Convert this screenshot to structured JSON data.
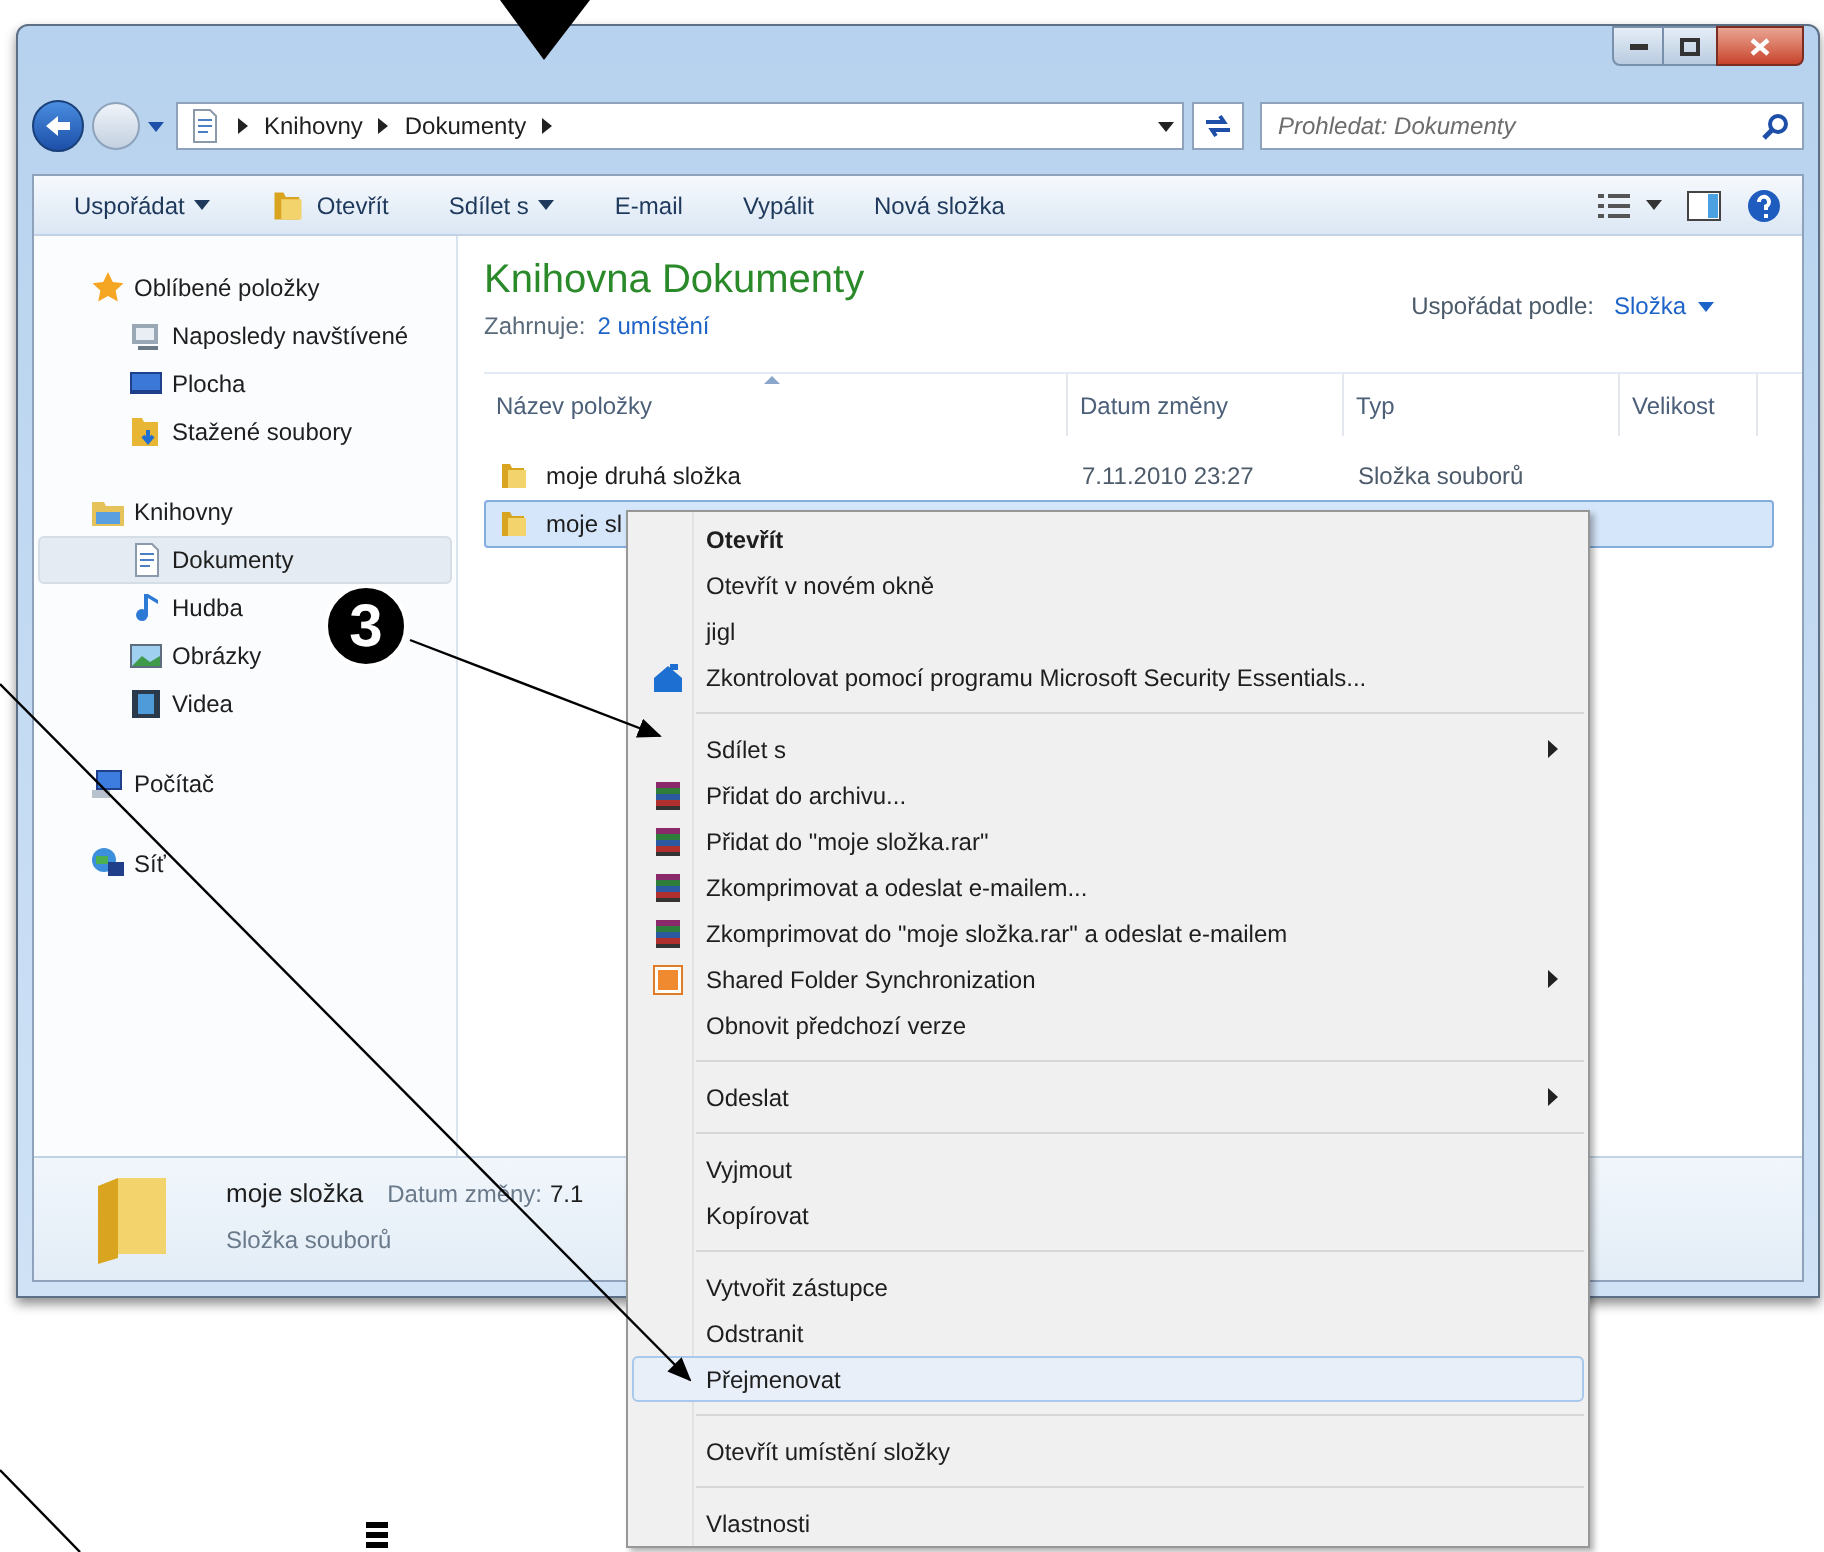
{
  "window": {
    "controls": [
      {
        "kind": "minimize"
      },
      {
        "kind": "maximize"
      },
      {
        "kind": "close"
      }
    ]
  },
  "address_bar": {
    "breadcrumb": [
      "Knihovny",
      "Dokumenty"
    ],
    "search": {
      "placeholder": "Prohledat: Dokumenty"
    }
  },
  "toolbar": {
    "buttons": [
      {
        "label": "Uspořádat",
        "kind": "dropdown"
      },
      {
        "label": "Otevřít",
        "kind": "open"
      },
      {
        "label": "Sdílet s",
        "kind": "dropdown"
      },
      {
        "label": "E-mail",
        "kind": "plain"
      },
      {
        "label": "Vypálit",
        "kind": "plain"
      },
      {
        "label": "Nová složka",
        "kind": "plain"
      }
    ]
  },
  "sidebar": {
    "sections": [
      {
        "label": "Oblíbené položky",
        "kind": "favorites",
        "selected": false,
        "children": [
          {
            "label": "Naposledy navštívené",
            "kind": "recent",
            "selected": false
          },
          {
            "label": "Plocha",
            "kind": "desktop",
            "selected": false
          },
          {
            "label": "Stažené soubory",
            "kind": "downloads",
            "selected": false
          }
        ]
      },
      {
        "label": "Knihovny",
        "kind": "libraries",
        "selected": false,
        "children": [
          {
            "label": "Dokumenty",
            "kind": "documents",
            "selected": true
          },
          {
            "label": "Hudba",
            "kind": "music",
            "selected": false
          },
          {
            "label": "Obrázky",
            "kind": "pictures",
            "selected": false
          },
          {
            "label": "Videa",
            "kind": "videos",
            "selected": false
          }
        ]
      },
      {
        "label": "Počítač",
        "kind": "computer",
        "selected": false
      },
      {
        "label": "Síť",
        "kind": "network",
        "selected": false
      }
    ]
  },
  "library": {
    "title": "Knihovna Dokumenty",
    "includes_label": "Zahrnuje:",
    "includes_link": "2 umístění",
    "arrange_label": "Uspořádat podle:",
    "arrange_value": "Složka"
  },
  "table": {
    "columns": [
      {
        "label": "Název položky",
        "sorted": true
      },
      {
        "label": "Datum změny"
      },
      {
        "label": "Typ"
      },
      {
        "label": "Velikost"
      }
    ],
    "rows": [
      {
        "name": "moje druhá složka",
        "date": "7.11.2010 23:27",
        "type": "Složka souborů",
        "selected": false
      },
      {
        "name": "moje sl",
        "selected": true
      }
    ]
  },
  "details_pane": {
    "name": "moje složka",
    "type": "Složka souborů",
    "date_label": "Datum změny:",
    "date_value": "7.1"
  },
  "context_menu": {
    "items": [
      {
        "kind": "item",
        "label": "Otevřít",
        "default": true
      },
      {
        "kind": "item",
        "label": "Otevřít v novém okně"
      },
      {
        "kind": "item",
        "label": "jigl"
      },
      {
        "kind": "security",
        "label": "Zkontrolovat pomocí programu Microsoft Security Essentials..."
      },
      {
        "kind": "separator"
      },
      {
        "kind": "item",
        "label": "Sdílet s",
        "submenu": true
      },
      {
        "kind": "archive",
        "label": "Přidat do archivu..."
      },
      {
        "kind": "archive",
        "label": "Přidat do \"moje složka.rar\""
      },
      {
        "kind": "archive",
        "label": "Zkomprimovat a odeslat e-mailem..."
      },
      {
        "kind": "archive",
        "label": "Zkomprimovat do \"moje složka.rar\" a odeslat e-mailem"
      },
      {
        "kind": "sync",
        "label": "Shared Folder Synchronization",
        "submenu": true
      },
      {
        "kind": "item",
        "label": "Obnovit předchozí verze"
      },
      {
        "kind": "separator"
      },
      {
        "kind": "item",
        "label": "Odeslat",
        "submenu": true
      },
      {
        "kind": "separator"
      },
      {
        "kind": "item",
        "label": "Vyjmout"
      },
      {
        "kind": "item",
        "label": "Kopírovat"
      },
      {
        "kind": "separator"
      },
      {
        "kind": "item",
        "label": "Vytvořit zástupce"
      },
      {
        "kind": "item",
        "label": "Odstranit"
      },
      {
        "kind": "item",
        "label": "Přejmenovat",
        "selected": true
      },
      {
        "kind": "separator"
      },
      {
        "kind": "item",
        "label": "Otevřít umístění složky"
      },
      {
        "kind": "separator"
      },
      {
        "kind": "item",
        "label": "Vlastnosti"
      }
    ]
  },
  "annotations": {
    "step": "3"
  }
}
